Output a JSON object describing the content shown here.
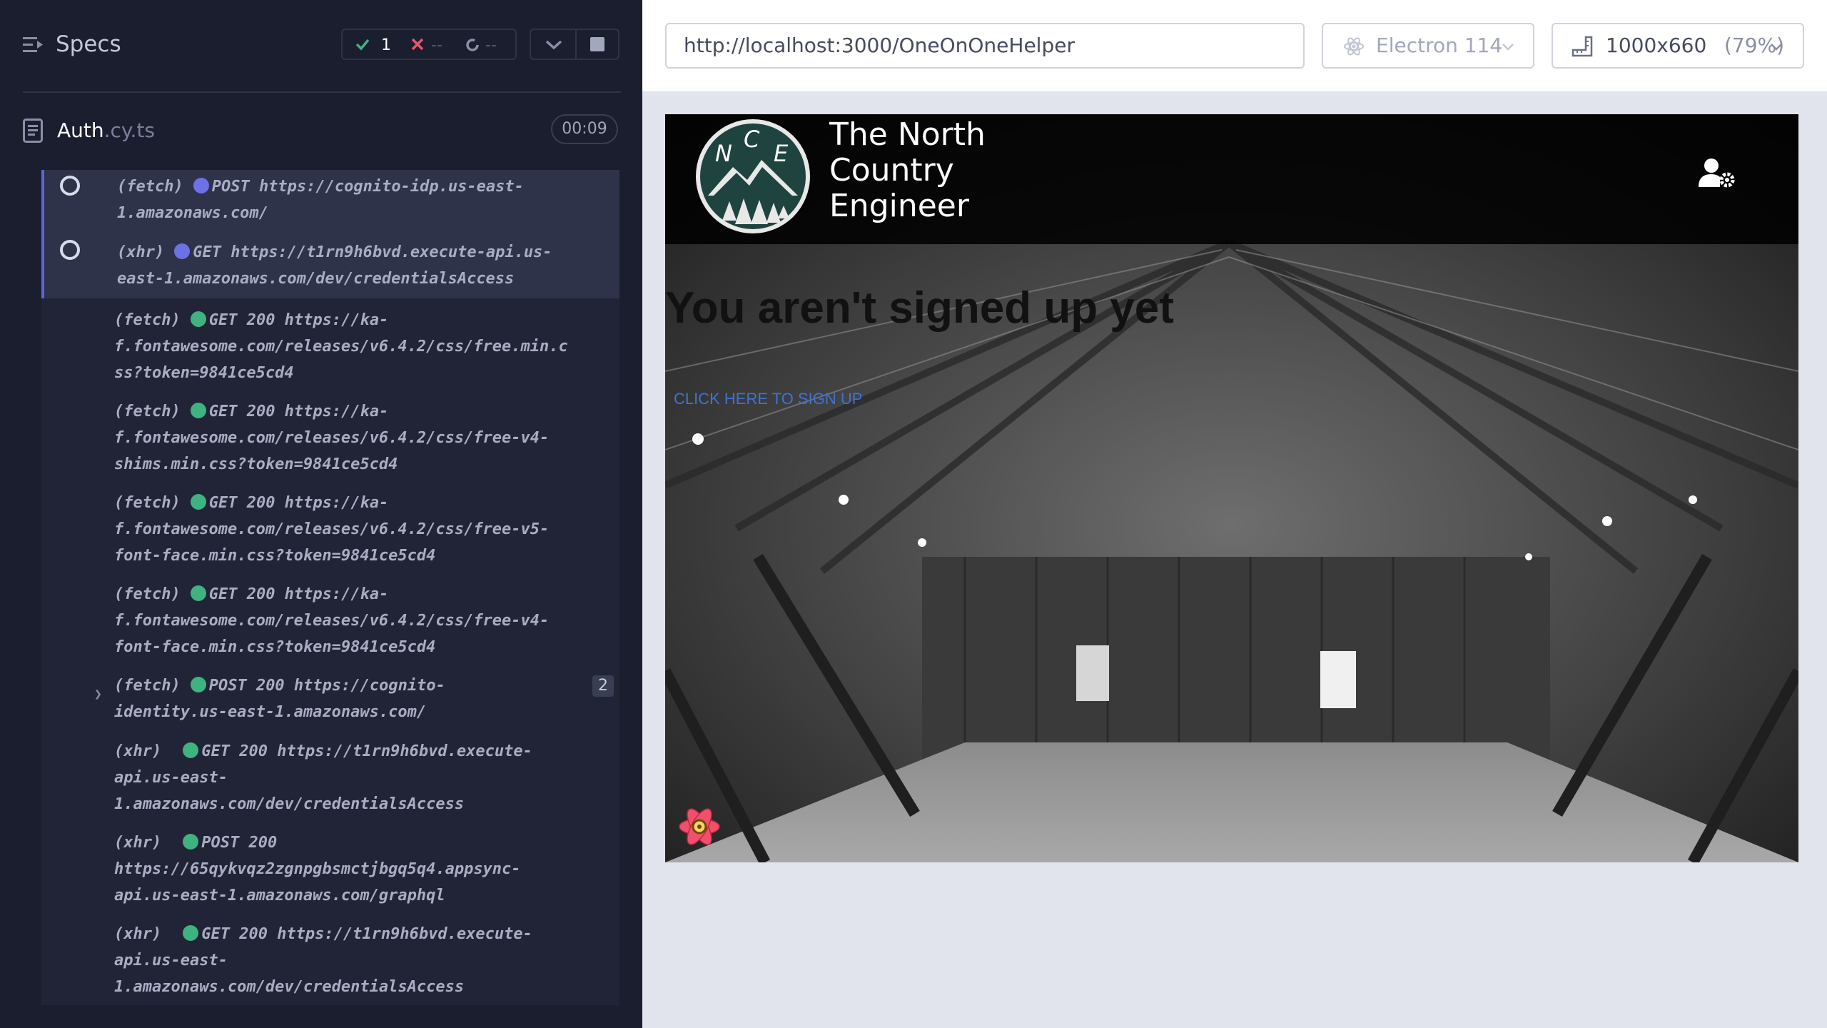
{
  "reporter": {
    "specs_title": "Specs",
    "stats": {
      "passed": "1",
      "failed": "--",
      "pending": "--"
    },
    "spec": {
      "name": "Auth",
      "ext": ".cy.ts",
      "duration": "00:09"
    },
    "commands": [
      {
        "type": "(fetch)",
        "status": "pending",
        "text": "POST https://cognito-idp.us-east-",
        "text2": "1.amazonaws.com/"
      },
      {
        "type": "(xhr)",
        "status": "pending",
        "text": "GET https://t1rn9h6bvd.execute-api.us-",
        "text2": "east-1.amazonaws.com/dev/credentialsAccess"
      },
      {
        "type": "(fetch)",
        "status": "done",
        "text": "GET 200 https://ka-",
        "text2": "f.fontawesome.com/releases/v6.4.2/css/free.min.c",
        "text3": "ss?token=9841ce5cd4"
      },
      {
        "type": "(fetch)",
        "status": "done",
        "text": "GET 200 https://ka-",
        "text2": "f.fontawesome.com/releases/v6.4.2/css/free-v4-",
        "text3": "shims.min.css?token=9841ce5cd4"
      },
      {
        "type": "(fetch)",
        "status": "done",
        "text": "GET 200 https://ka-",
        "text2": "f.fontawesome.com/releases/v6.4.2/css/free-v5-",
        "text3": "font-face.min.css?token=9841ce5cd4"
      },
      {
        "type": "(fetch)",
        "status": "done",
        "text": "GET 200 https://ka-",
        "text2": "f.fontawesome.com/releases/v6.4.2/css/free-v4-",
        "text3": "font-face.min.css?token=9841ce5cd4"
      },
      {
        "type": "(fetch)",
        "status": "done",
        "text": "POST 200 https://cognito-",
        "text2": "identity.us-east-1.amazonaws.com/",
        "badge": "2"
      },
      {
        "type": "(xhr)",
        "status": "done",
        "text": "GET 200 https://t1rn9h6bvd.execute-",
        "text2": "api.us-east-",
        "text3": "1.amazonaws.com/dev/credentialsAccess"
      },
      {
        "type": "(xhr)",
        "status": "done",
        "text": "POST 200",
        "text2": "https://65qykvqz2zgnpgbsmctjbgq5q4.appsync-",
        "text3": "api.us-east-1.amazonaws.com/graphql"
      },
      {
        "type": "(xhr)",
        "status": "done",
        "text": "GET 200 https://t1rn9h6bvd.execute-",
        "text2": "api.us-east-",
        "text3": "1.amazonaws.com/dev/credentialsAccess"
      }
    ]
  },
  "toolbar": {
    "url": "http://localhost:3000/OneOnOneHelper",
    "browser": "Electron 114",
    "viewport": "1000x660",
    "viewport_scale": "(79%)"
  },
  "app": {
    "logo_letters": [
      "N",
      "C",
      "E"
    ],
    "site_title_lines": [
      "The North",
      "Country",
      "Engineer"
    ],
    "heading": "You aren't signed up yet",
    "signup_link": "CLICK HERE TO SIGN UP"
  },
  "colors": {
    "reporter_bg": "#1b1e2e",
    "pending_dot": "#6c72e6",
    "done_dot": "#3fb37f",
    "pass_check": "#3fb37f",
    "fail_x": "#e45770",
    "link": "#3f73d1"
  },
  "icons": {
    "specs_menu": "list-collapse-icon",
    "spec_file": "document-icon",
    "browser": "electron-icon",
    "viewport": "ruler-icon",
    "user_settings": "user-gear-icon",
    "react_devtools": "react-icon"
  }
}
